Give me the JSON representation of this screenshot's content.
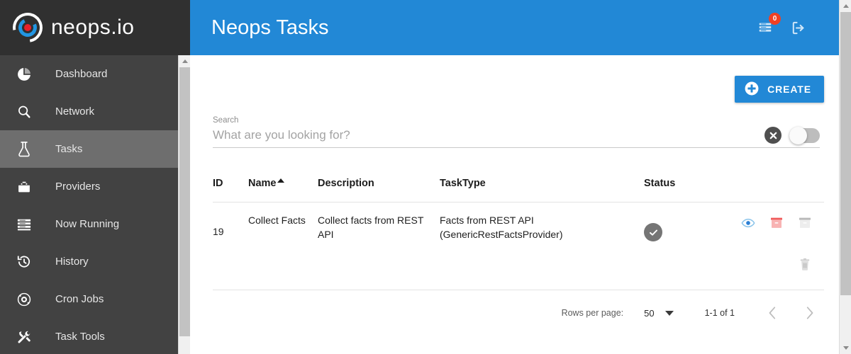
{
  "brand": {
    "name": "neops.io",
    "logo_icon": "neops-target-logo-icon"
  },
  "sidebar": {
    "items": [
      {
        "label": "Dashboard",
        "icon": "pie-chart-icon",
        "active": false
      },
      {
        "label": "Network",
        "icon": "magnifier-icon",
        "active": false
      },
      {
        "label": "Tasks",
        "icon": "flask-icon",
        "active": true
      },
      {
        "label": "Providers",
        "icon": "toolbox-icon",
        "active": false
      },
      {
        "label": "Now Running",
        "icon": "server-list-icon",
        "active": false
      },
      {
        "label": "History",
        "icon": "history-clock-icon",
        "active": false
      },
      {
        "label": "Cron Jobs",
        "icon": "cron-orbit-icon",
        "active": false
      },
      {
        "label": "Task Tools",
        "icon": "tools-icon",
        "active": false
      }
    ]
  },
  "header": {
    "title": "Neops Tasks",
    "notifications": {
      "icon": "notification-list-icon",
      "badge_count": "0",
      "badge_color": "#f04124"
    },
    "logout": {
      "icon": "logout-icon"
    },
    "background_color": "#2288d6"
  },
  "toolbar": {
    "create_label": "CREATE",
    "create_icon": "plus-circle-icon",
    "create_color": "#2288d6"
  },
  "search": {
    "label": "Search",
    "value": "",
    "placeholder": "What are you looking for?",
    "clear_icon": "clear-circle-x-icon",
    "toggle": {
      "name": "show-inactive-toggle",
      "state": "off"
    }
  },
  "table": {
    "columns": [
      {
        "key": "id",
        "label": "ID",
        "sorted": false
      },
      {
        "key": "name",
        "label": "Name",
        "sorted": true,
        "sort_dir": "asc"
      },
      {
        "key": "desc",
        "label": "Description",
        "sorted": false
      },
      {
        "key": "tasktype",
        "label": "TaskType",
        "sorted": false
      },
      {
        "key": "status",
        "label": "Status",
        "sorted": false
      }
    ],
    "rows": [
      {
        "id": "19",
        "name": "Collect Facts",
        "description": "Collect facts from REST API",
        "tasktype": "Facts from REST API (GenericRestFactsProvider)",
        "status_icon": "check-circle-icon",
        "status_color": "#757575",
        "actions": [
          {
            "name": "view-icon",
            "icon": "eye-icon",
            "color": "#2288d6"
          },
          {
            "name": "archive-red-icon",
            "icon": "archive-icon",
            "color": "#f4a0a0"
          },
          {
            "name": "archive-gray-icon",
            "icon": "archive-icon",
            "color": "#dedede"
          },
          {
            "name": "delete-icon",
            "icon": "trash-icon",
            "color": "#d6d6d6"
          }
        ]
      }
    ]
  },
  "paginator": {
    "rows_per_page_label": "Rows per page:",
    "rows_per_page_value": "50",
    "range_label": "1-1 of 1",
    "prev_icon": "chevron-left-icon",
    "next_icon": "chevron-right-icon"
  }
}
